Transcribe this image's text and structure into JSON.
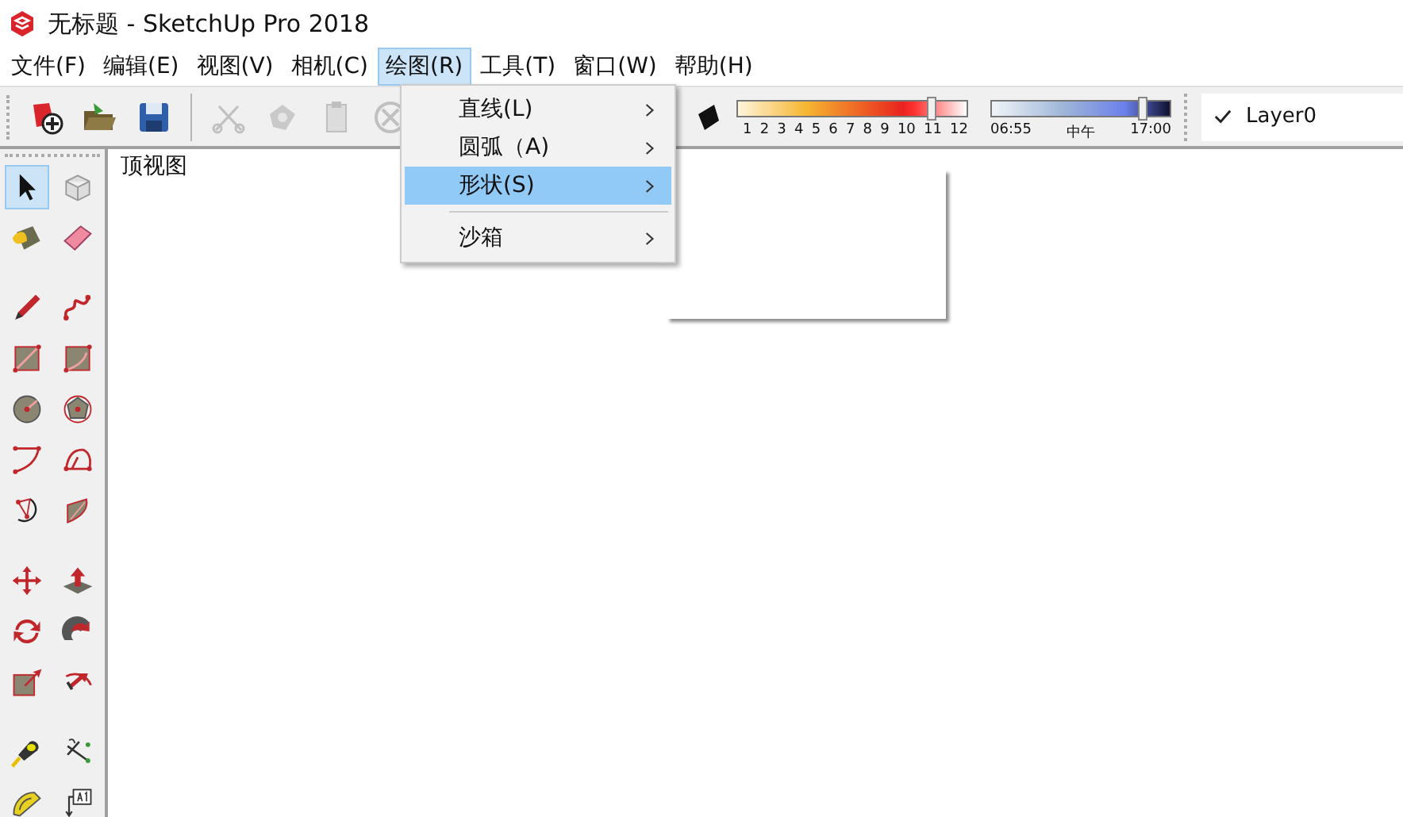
{
  "window": {
    "title": "无标题 - SketchUp Pro 2018"
  },
  "menu_bar": [
    {
      "label": "文件(F)",
      "selected": false
    },
    {
      "label": "编辑(E)",
      "selected": false
    },
    {
      "label": "视图(V)",
      "selected": false
    },
    {
      "label": "相机(C)",
      "selected": false
    },
    {
      "label": "绘图(R)",
      "selected": true
    },
    {
      "label": "工具(T)",
      "selected": false
    },
    {
      "label": "窗口(W)",
      "selected": false
    },
    {
      "label": "帮助(H)",
      "selected": false
    }
  ],
  "toolbar": {
    "buttons": [
      {
        "disabled": false
      },
      {
        "disabled": false
      },
      {
        "disabled": false
      },
      {
        "disabled": true
      },
      {
        "disabled": true
      },
      {
        "disabled": true
      },
      {
        "disabled": true
      }
    ],
    "month_slider": {
      "level": 0.84,
      "labels": [
        "1",
        "2",
        "3",
        "4",
        "5",
        "6",
        "7",
        "8",
        "9",
        "10",
        "11",
        "12"
      ]
    },
    "time_slider": {
      "level": 0.84,
      "labels": [
        "06:55",
        "中午",
        "17:00"
      ]
    },
    "layer": {
      "checked": true,
      "name": "Layer0"
    }
  },
  "dropdown": {
    "items": [
      {
        "kind": "item",
        "label": "直线(L)",
        "selected": false
      },
      {
        "kind": "item",
        "label": "圆弧（A)",
        "selected": false
      },
      {
        "kind": "item",
        "label": "形状(S)",
        "selected": true
      },
      {
        "kind": "separator"
      },
      {
        "kind": "item",
        "label": "沙箱",
        "selected": false
      }
    ],
    "submenu_open": true
  },
  "tool_palette": [
    [
      {
        "selected": true
      },
      {
        "selected": false
      },
      {
        "selected": false
      },
      {
        "selected": false
      }
    ],
    [
      {
        "selected": false
      },
      {
        "selected": false
      },
      {
        "selected": false
      },
      {
        "selected": false
      },
      {
        "selected": false
      },
      {
        "selected": false
      },
      {
        "selected": false
      },
      {
        "selected": false
      },
      {
        "selected": false
      },
      {
        "selected": false
      }
    ],
    [
      {
        "selected": false
      },
      {
        "selected": false
      },
      {
        "selected": false
      },
      {
        "selected": false
      },
      {
        "selected": false
      },
      {
        "selected": false
      }
    ],
    [
      {
        "selected": false
      },
      {
        "selected": false
      },
      {
        "selected": false
      },
      {
        "selected": false
      }
    ]
  ],
  "viewport": {
    "view_label": "顶视图"
  }
}
